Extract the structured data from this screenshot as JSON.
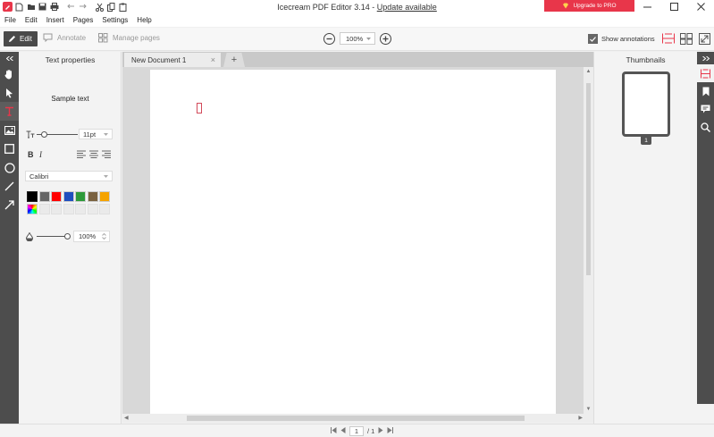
{
  "app": {
    "title": "Icecream PDF Editor 3.14 - ",
    "update_link": "Update available",
    "upgrade_label": "Upgrade to PRO",
    "brand_color": "#e8364a"
  },
  "menu": [
    "File",
    "Edit",
    "Insert",
    "Pages",
    "Settings",
    "Help"
  ],
  "modes": {
    "edit": "Edit",
    "annotate": "Annotate",
    "manage_pages": "Manage pages"
  },
  "zoom": {
    "value": "100%"
  },
  "show_annotations": {
    "label": "Show annotations",
    "checked": true
  },
  "props": {
    "title": "Text properties",
    "sample": "Sample text",
    "size": "11pt",
    "bold": "B",
    "italic": "I",
    "font": "Calibri",
    "colors": [
      "#000000",
      "#666666",
      "#ff0000",
      "#1f4fbf",
      "#2e9a3a",
      "#7a6240",
      "#f5a300"
    ],
    "opacity": "100%"
  },
  "tabs": {
    "doc": "New Document 1",
    "close": "×",
    "add": "+"
  },
  "thumbnails": {
    "title": "Thumbnails",
    "page_num": "1"
  },
  "pager": {
    "current": "1",
    "total": "/ 1"
  }
}
